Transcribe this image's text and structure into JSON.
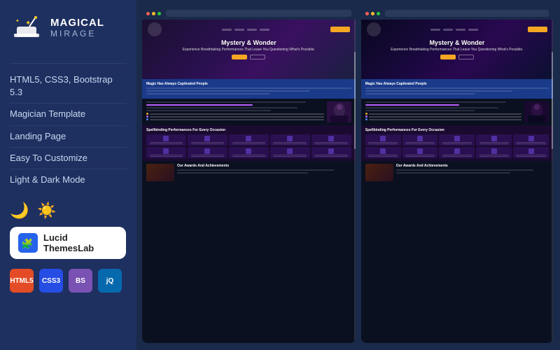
{
  "sidebar": {
    "brand_name": "MAGICAL",
    "brand_sub": "MIRAGE",
    "features": [
      {
        "label": "HTML5, CSS3, Bootstrap 5.3"
      },
      {
        "label": "Magician Template"
      },
      {
        "label": "Landing Page"
      },
      {
        "label": "Easy To Customize"
      },
      {
        "label": "Light & Dark Mode"
      }
    ],
    "lucid_text": "Lucid ThemesLab",
    "badges": [
      {
        "label": "HTML5",
        "class": "badge-html"
      },
      {
        "label": "CSS3",
        "class": "badge-css"
      },
      {
        "label": "BS",
        "class": "badge-bootstrap"
      },
      {
        "label": "jQ",
        "class": "badge-jquery"
      }
    ]
  },
  "hero": {
    "title": "Mystery & Wonder",
    "subtitle": "Experience Breathtaking Performances That\nLeave You Questioning What's Possible."
  },
  "sections": {
    "magic_title": "Magic Has Always Captivated People",
    "allure_title": "The Allure Of Magic Has Always Enchanted People",
    "services_title": "Spellbinding Performances For Every Occasion",
    "awards_title": "Our Awards And Achievements"
  },
  "colors": {
    "accent_orange": "#f5a623",
    "accent_purple": "#c060ff",
    "hero_bg": "#2a1050",
    "blue_section": "#1a3a8a",
    "dark_bg": "#0a1020"
  }
}
